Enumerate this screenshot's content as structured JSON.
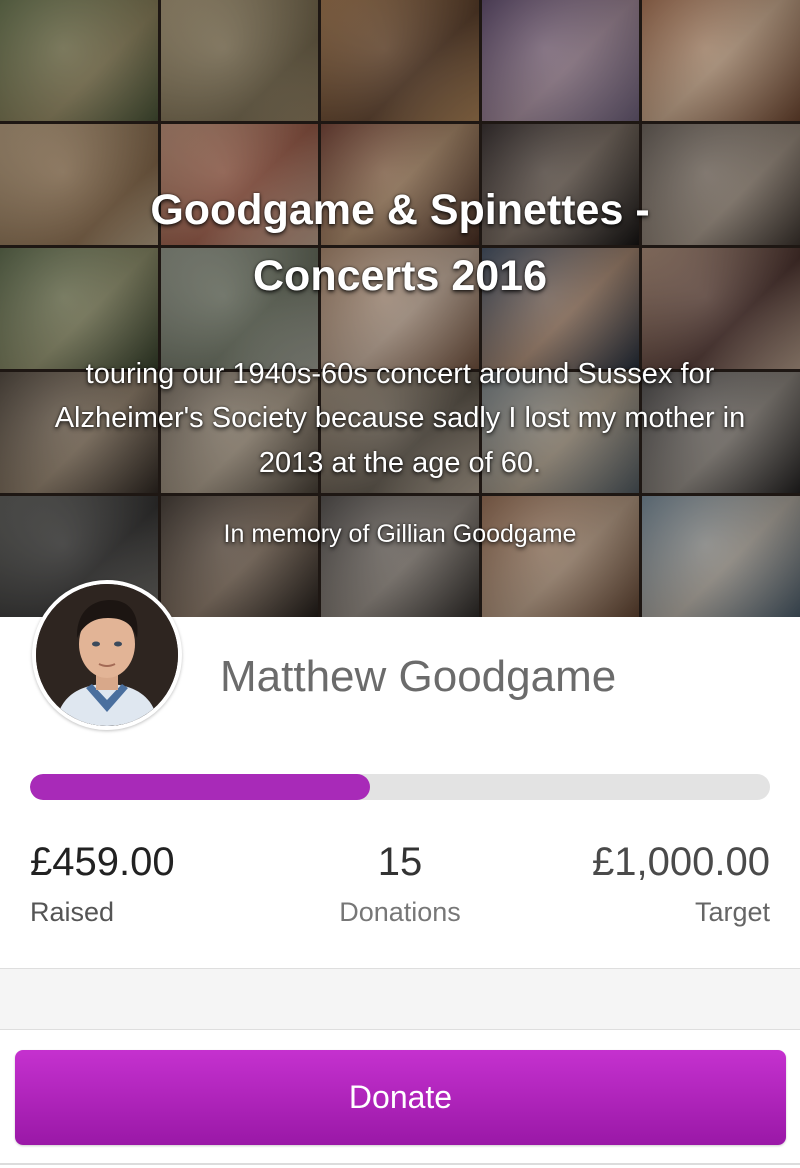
{
  "hero": {
    "title": "Goodgame & Spinettes - Concerts 2016",
    "description": "touring our 1940s-60s concert around Sussex for Alzheimer's Society because sadly I lost my mother in 2013 at the age of 60.",
    "memory": "In memory of Gillian Goodgame",
    "background": "photo-collage"
  },
  "owner": {
    "name": "Matthew Goodgame",
    "avatar": "profile-photo"
  },
  "progress": {
    "percent": 45.9,
    "fill_color": "#a82ab8",
    "track_color": "#e3e3e3"
  },
  "stats": {
    "raised_value": "£459.00",
    "raised_label": "Raised",
    "donations_value": "15",
    "donations_label": "Donations",
    "target_value": "£1,000.00",
    "target_label": "Target"
  },
  "actions": {
    "donate_label": "Donate",
    "accent_color": "#b325c0"
  }
}
